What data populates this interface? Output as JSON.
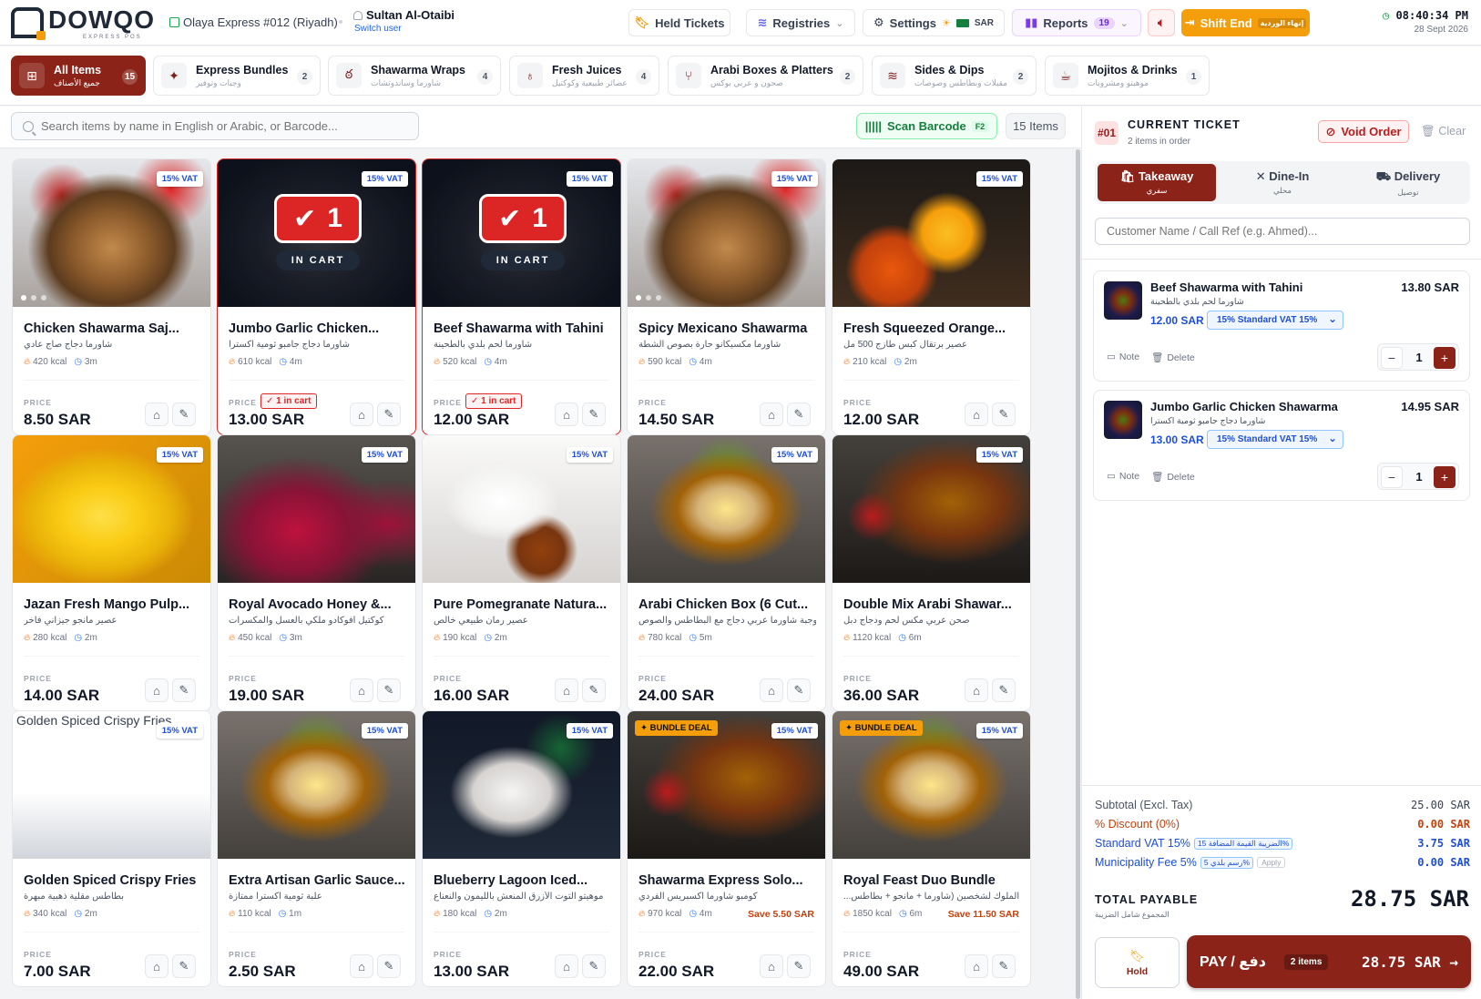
{
  "brand": {
    "name": "DOWQO",
    "sub": "EXPRESS POS"
  },
  "header": {
    "branch": "Olaya Express #012 (Riyadh)",
    "user": "Sultan Al-Otaibi",
    "switch_user": "Switch user",
    "held_tickets": "Held Tickets",
    "registries": "Registries",
    "settings": "Settings",
    "currency": "SAR",
    "reports": "Reports",
    "reports_count": "19",
    "shift_end": "Shift End",
    "shift_end_ar": "إنهاء الوردية",
    "time": "08:40:34 PM",
    "date": "28 Sept 2026"
  },
  "categories": [
    {
      "name": "All Items",
      "ar": "جميع الأصناف",
      "count": "15"
    },
    {
      "name": "Express Bundles",
      "ar": "وجبات وتوفير",
      "count": "2"
    },
    {
      "name": "Shawarma Wraps",
      "ar": "شاورما وساندوتشات",
      "count": "4"
    },
    {
      "name": "Fresh Juices",
      "ar": "عصائر طبيعية وكوكتيل",
      "count": "4"
    },
    {
      "name": "Arabi Boxes & Platters",
      "ar": "صحون و عربي بوكس",
      "count": "2"
    },
    {
      "name": "Sides & Dips",
      "ar": "مقبلات وبطاطس وصوصات",
      "count": "2"
    },
    {
      "name": "Mojitos & Drinks",
      "ar": "موهيتو ومشروبات",
      "count": "1"
    }
  ],
  "search": {
    "placeholder": "Search items by name in English or Arabic, or Barcode...",
    "scan": "Scan Barcode",
    "scan_key": "F2",
    "items_count": "15 Items"
  },
  "labels": {
    "vat": "15% VAT",
    "price": "PRICE",
    "in_cart": "IN CART",
    "bundle": "BUNDLE DEAL"
  },
  "products": [
    {
      "name": "Chicken Shawarma Saj...",
      "ar": "شاورما دجاج صاج عادي",
      "kcal": "420 kcal",
      "time": "3m",
      "price": "8.50 SAR",
      "img": "shawarma"
    },
    {
      "name": "Jumbo Garlic Chicken...",
      "ar": "شاورما دجاج جامبو ثومية اكسترا",
      "kcal": "610 kcal",
      "time": "4m",
      "price": "13.00 SAR",
      "img": "dark",
      "in_cart": "1",
      "cart_badge": "✓ 1 in cart"
    },
    {
      "name": "Beef Shawarma with Tahini",
      "ar": "شاورما لحم بلدي بالطحينة",
      "kcal": "520 kcal",
      "time": "4m",
      "price": "12.00 SAR",
      "img": "dark",
      "in_cart": "1",
      "cart_badge": "✓ 1 in cart"
    },
    {
      "name": "Spicy Mexicano Shawarma",
      "ar": "شاورما مكسيكانو حارة بصوص الشطة",
      "kcal": "590 kcal",
      "time": "4m",
      "price": "14.50 SAR",
      "img": "shawarma"
    },
    {
      "name": "Fresh Squeezed Orange...",
      "ar": "عصير برتقال كبس طازج 500 مل",
      "kcal": "210 kcal",
      "time": "2m",
      "price": "12.00 SAR",
      "img": "orange"
    },
    {
      "name": "Jazan Fresh Mango Pulp...",
      "ar": "عصير مانجو جيزاني فاخر",
      "kcal": "280 kcal",
      "time": "2m",
      "price": "14.00 SAR",
      "img": "mango"
    },
    {
      "name": "Royal Avocado Honey &...",
      "ar": "كوكتيل أفوكادو ملكي بالعسل والمكسرات",
      "kcal": "450 kcal",
      "time": "3m",
      "price": "19.00 SAR",
      "img": "berry"
    },
    {
      "name": "Pure Pomegranate Natura...",
      "ar": "عصير رمان طبيعي خالص",
      "kcal": "190 kcal",
      "time": "2m",
      "price": "16.00 SAR",
      "img": "coffee"
    },
    {
      "name": "Arabi Chicken Box (6 Cut...",
      "ar": "وجبة شاورما عربي دجاج مع البطاطس والصوص",
      "kcal": "780 kcal",
      "time": "5m",
      "price": "24.00 SAR",
      "img": "wrap"
    },
    {
      "name": "Double Mix Arabi Shawar...",
      "ar": "صحن عربي مكس لحم ودجاج دبل",
      "kcal": "1120 kcal",
      "time": "6m",
      "price": "36.00 SAR",
      "img": "platter"
    },
    {
      "name": "Golden Spiced Crispy Fries",
      "ar": "بطاطس مقلية ذهبية مبهرة",
      "kcal": "340 kcal",
      "time": "2m",
      "price": "7.00 SAR",
      "img": "broken",
      "alt": "Golden Spiced Crispy Fries"
    },
    {
      "name": "Extra Artisan Garlic Sauce...",
      "ar": "علبة ثومية اكسترا ممتازة",
      "kcal": "110 kcal",
      "time": "1m",
      "price": "2.50 SAR",
      "img": "wrap"
    },
    {
      "name": "Blueberry Lagoon Iced...",
      "ar": "موهيتو التوت الأزرق المنعش بالليمون والنعناع",
      "kcal": "180 kcal",
      "time": "2m",
      "price": "13.00 SAR",
      "img": "mojito"
    },
    {
      "name": "Shawarma Express Solo...",
      "ar": "كومبو شاورما اكسبريس الفردي",
      "kcal": "970 kcal",
      "time": "4m",
      "price": "22.00 SAR",
      "img": "platter",
      "bundle": true,
      "save": "Save 5.50 SAR"
    },
    {
      "name": "Royal Feast Duo Bundle",
      "ar": "...فة الملوك لشخصين (شاورما + مانجو + بطاطس",
      "kcal": "1850 kcal",
      "time": "6m",
      "price": "49.00 SAR",
      "img": "wrap",
      "bundle": true,
      "save": "Save 11.50 SAR"
    }
  ],
  "ticket": {
    "number": "#01",
    "title": "CURRENT TICKET",
    "subtitle": "2 items in order",
    "void": "Void Order",
    "clear": "Clear",
    "modes": [
      {
        "label": "Takeaway",
        "ar": "سفري"
      },
      {
        "label": "Dine-In",
        "ar": "محلي"
      },
      {
        "label": "Delivery",
        "ar": "توصيل"
      }
    ],
    "customer_placeholder": "Customer Name / Call Ref (e.g. Ahmed)...",
    "lines": [
      {
        "name": "Beef Shawarma with Tahini",
        "ar": "شاورما لحم بلدي بالطحينة",
        "unit": "12.00 SAR",
        "vat": "15% Standard VAT 15%",
        "total": "13.80 SAR",
        "qty": "1"
      },
      {
        "name": "Jumbo Garlic Chicken Shawarma",
        "ar": "شاورما دجاج جامبو ثومية اكسترا",
        "unit": "13.00 SAR",
        "vat": "15% Standard VAT 15%",
        "total": "14.95 SAR",
        "qty": "1"
      }
    ],
    "note": "Note",
    "delete": "Delete"
  },
  "totals": {
    "subtotal_label": "Subtotal (Excl. Tax)",
    "subtotal": "25.00 SAR",
    "discount_label": "% Discount (0%)",
    "discount": "0.00 SAR",
    "vat_label": "Standard VAT 15%",
    "vat_chip": "15 الضريبة القيمة المضافة%",
    "vat": "3.75 SAR",
    "muni_label": "Municipality Fee 5%",
    "muni_chip": "5 رسم بلدي%",
    "apply": "Apply",
    "muni": "0.00 SAR",
    "total_label": "TOTAL PAYABLE",
    "total_ar": "المجموع شامل الضريبة",
    "total": "28.75 SAR"
  },
  "actions": {
    "hold": "Hold",
    "pay": "PAY / دفع",
    "pay_items": "2 items",
    "pay_total": "28.75 SAR →"
  }
}
